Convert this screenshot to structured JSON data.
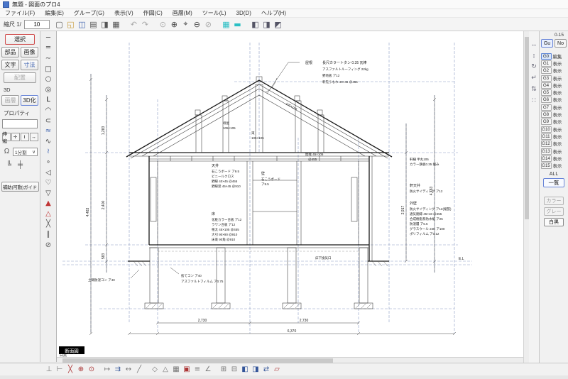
{
  "window": {
    "title": "無題 - 図面のプロ4"
  },
  "menu": {
    "items": [
      "ファイル(F)",
      "編集(E)",
      "グループ(G)",
      "表示(V)",
      "作図(C)",
      "画層(M)",
      "ツール(L)",
      "3D(D)",
      "ヘルプ(H)"
    ]
  },
  "toolbar": {
    "scale_label": "縮尺 1/",
    "scale_value": "10",
    "icons": [
      {
        "name": "new-icon",
        "glyph": "▢",
        "color": "#555"
      },
      {
        "name": "open-icon",
        "glyph": "◱",
        "color": "#c79b3b"
      },
      {
        "name": "save-icon",
        "glyph": "◫",
        "color": "#3a5fae"
      },
      {
        "name": "print-preview-icon",
        "glyph": "▤",
        "color": "#555"
      },
      {
        "name": "plot-icon",
        "glyph": "◨",
        "color": "#555"
      },
      {
        "name": "print-icon",
        "glyph": "▦",
        "color": "#555"
      },
      {
        "name": "sep1"
      },
      {
        "name": "undo-icon",
        "glyph": "↶",
        "color": "#aaaaaa"
      },
      {
        "name": "redo-icon",
        "glyph": "↷",
        "color": "#aaaaaa"
      },
      {
        "name": "sep2"
      },
      {
        "name": "zoom-all-icon",
        "glyph": "⊙",
        "color": "#aaaaaa"
      },
      {
        "name": "zoom-in-icon",
        "glyph": "⊕",
        "color": "#444"
      },
      {
        "name": "zoom-pan-icon",
        "glyph": "⌖",
        "color": "#444"
      },
      {
        "name": "zoom-out-icon",
        "glyph": "⊖",
        "color": "#444"
      },
      {
        "name": "zoom-window-icon",
        "glyph": "⊘",
        "color": "#aaaaaa"
      },
      {
        "name": "sep3"
      },
      {
        "name": "grid-icon",
        "glyph": "▦",
        "color": "#2bbfc4"
      },
      {
        "name": "paper-icon",
        "glyph": "▬",
        "color": "#2bbfc4"
      },
      {
        "name": "sep4"
      },
      {
        "name": "layer-window-icon",
        "glyph": "◧",
        "color": "#556"
      },
      {
        "name": "parts-window-icon",
        "glyph": "◨",
        "color": "#556"
      },
      {
        "name": "props-window-icon",
        "glyph": "◩",
        "color": "#556"
      }
    ]
  },
  "left_panel": {
    "select": "選択",
    "parts": "部品",
    "image": "画像",
    "text": "文字",
    "dimension": "寸法",
    "layout": "配置",
    "threed_label": "3D",
    "layer_btn": "画層",
    "to3d": "3D化",
    "property_label": "プロパティ",
    "mini_buttons": [
      "伸縮",
      "✛",
      "Ⅰ",
      "↔"
    ],
    "snap_value": "1分割",
    "snap_caret": "∨",
    "magnet_glyph": "Ω",
    "snap_icons": [
      "╚",
      "╪"
    ],
    "guide_button": "補助(可動)ガイド"
  },
  "tool_strip": {
    "tools": [
      {
        "name": "line-tool",
        "glyph": "─",
        "color": "#444"
      },
      {
        "name": "double-line-tool",
        "glyph": "═",
        "color": "#444"
      },
      {
        "name": "spline-tool",
        "glyph": "∼",
        "color": "#444"
      },
      {
        "name": "rect-tool",
        "glyph": "□",
        "color": "#444"
      },
      {
        "name": "circle-tool",
        "glyph": "○",
        "color": "#444"
      },
      {
        "name": "concentric-tool",
        "glyph": "◎",
        "color": "#444"
      },
      {
        "name": "polyline-tool",
        "glyph": "L",
        "color": "#111"
      },
      {
        "name": "arc-tool",
        "glyph": "◠",
        "color": "#444"
      },
      {
        "name": "arc3-tool",
        "glyph": "⊂",
        "color": "#444"
      },
      {
        "name": "wave-tool",
        "glyph": "≈",
        "color": "#3a5fae"
      },
      {
        "name": "freecurve-tool",
        "glyph": "∿",
        "color": "#444"
      },
      {
        "name": "curve-tool",
        "glyph": "≀",
        "color": "#3a5fae"
      },
      {
        "name": "point-tool",
        "glyph": "∘",
        "color": "#444"
      },
      {
        "name": "balloon-tool",
        "glyph": "◁",
        "color": "#444"
      },
      {
        "name": "cloud-tool",
        "glyph": "♡",
        "color": "#444"
      },
      {
        "name": "hatch-tool",
        "glyph": "▽",
        "color": "#444"
      },
      {
        "name": "fill-tool",
        "glyph": "▲",
        "color": "#c03535"
      },
      {
        "name": "pattern-tool",
        "glyph": "△",
        "color": "#c03535"
      },
      {
        "name": "cut-tool",
        "glyph": "╳",
        "color": "#555"
      },
      {
        "name": "offset-tool",
        "glyph": "∥",
        "color": "#555"
      },
      {
        "name": "erase-tool",
        "glyph": "⊘",
        "color": "#555"
      }
    ]
  },
  "right_toolbar": {
    "icons": [
      {
        "name": "scroll-horizontal-icon",
        "glyph": "↔"
      },
      {
        "name": "scroll-vertical-icon",
        "glyph": "↕"
      },
      {
        "name": "view-rotate-icon",
        "glyph": "↻"
      },
      {
        "name": "view-back-icon",
        "glyph": "↵"
      },
      {
        "name": "view-updown-icon",
        "glyph": "⇅"
      },
      {
        "name": "view-grid-icon",
        "glyph": "∷"
      }
    ]
  },
  "layer_panel": {
    "range_label": "0-15",
    "group_button": "Gu",
    "number_button": "No",
    "layers": [
      {
        "id": "G0",
        "state": "編集",
        "active": true
      },
      {
        "id": "G1",
        "state": "表示"
      },
      {
        "id": "G2",
        "state": "表示"
      },
      {
        "id": "G3",
        "state": "表示"
      },
      {
        "id": "G4",
        "state": "表示"
      },
      {
        "id": "G5",
        "state": "表示"
      },
      {
        "id": "G6",
        "state": "表示"
      },
      {
        "id": "G7",
        "state": "表示"
      },
      {
        "id": "G8",
        "state": "表示"
      },
      {
        "id": "G9",
        "state": "表示"
      },
      {
        "id": "G10",
        "state": "表示"
      },
      {
        "id": "G11",
        "state": "表示"
      },
      {
        "id": "G12",
        "state": "表示"
      },
      {
        "id": "G13",
        "state": "表示"
      },
      {
        "id": "G14",
        "state": "表示"
      },
      {
        "id": "G15",
        "state": "表示"
      }
    ],
    "all_label": "ALL",
    "list_button": "一覧",
    "color_modes": [
      {
        "label": "カラー"
      },
      {
        "label": "グレー"
      },
      {
        "label": "白黒",
        "active": true
      }
    ]
  },
  "bottom_toolbar": {
    "icons": [
      {
        "name": "snap-end-icon",
        "glyph": "⊥",
        "color": "#777"
      },
      {
        "name": "snap-mid-icon",
        "glyph": "⊢",
        "color": "#777"
      },
      {
        "name": "snap-int-icon",
        "glyph": "╳",
        "color": "#a33"
      },
      {
        "name": "snap-center-icon",
        "glyph": "⊕",
        "color": "#a33"
      },
      {
        "name": "snap-on-icon",
        "glyph": "⊙",
        "color": "#a33"
      },
      {
        "name": "sep1"
      },
      {
        "name": "move-icon",
        "glyph": "↦",
        "color": "#777"
      },
      {
        "name": "copy-icon",
        "glyph": "⇉",
        "color": "#359"
      },
      {
        "name": "stretch-icon",
        "glyph": "↔",
        "color": "#777"
      },
      {
        "name": "line-edit-icon",
        "glyph": "╱",
        "color": "#777"
      },
      {
        "name": "sep2"
      },
      {
        "name": "rect-edit-icon",
        "glyph": "◇",
        "color": "#777"
      },
      {
        "name": "poly-edit-icon",
        "glyph": "△",
        "color": "#777"
      },
      {
        "name": "hatch-edit-icon",
        "glyph": "▦",
        "color": "#777"
      },
      {
        "name": "fill-edit-icon",
        "glyph": "▣",
        "color": "#a33"
      },
      {
        "name": "text-edit-icon",
        "glyph": "≡",
        "color": "#777"
      },
      {
        "name": "measure-icon",
        "glyph": "∠",
        "color": "#777"
      },
      {
        "name": "sep3"
      },
      {
        "name": "group-icon",
        "glyph": "⊞",
        "color": "#777"
      },
      {
        "name": "ungroup-icon",
        "glyph": "⊟",
        "color": "#777"
      },
      {
        "name": "bring-front-icon",
        "glyph": "◧",
        "color": "#359"
      },
      {
        "name": "send-back-icon",
        "glyph": "◨",
        "color": "#359"
      },
      {
        "name": "swap-icon",
        "glyph": "⇄",
        "color": "#359"
      },
      {
        "name": "window-edit-icon",
        "glyph": "▱",
        "color": "#a33"
      }
    ]
  },
  "canvas": {
    "view_label": "断面図",
    "mode_label": "白黒",
    "annotations": {
      "roof_spec": {
        "label": "屋根",
        "lines": [
          "長尺カラートタン 0.35 瓦棒",
          "アスファルトルーフィング 22kg",
          "野地板 ア12",
          "軒先うもれ 40×45 @455"
        ]
      },
      "framing": {
        "moya_label": "母屋",
        "moya_size": "105×105",
        "tsuka_label": "束",
        "tsuka_size": "105×105",
        "slope_size": "105×105"
      },
      "ceiling": {
        "label": "天井",
        "lines": [
          "石こうボード ア9.5",
          "ビニールクロス",
          "野縁 40×45 @455",
          "野縁受 45×45 @910"
        ]
      },
      "wall": {
        "label": "壁",
        "lines": [
          "石こうボード",
          "ア9.5"
        ]
      },
      "floor": {
        "label": "床",
        "lines": [
          "化粧カラー合板 ア12",
          "ラワン合板 ア12",
          "根太 45×105 @455",
          "大引 90×90 @910",
          "床束 90角 @910"
        ]
      },
      "stud": {
        "lines": [
          "間柱 45×105",
          "@455"
        ]
      },
      "gutter": {
        "lines": [
          "軒樋 半丸105",
          "カラー鉄板0.35 掴み"
        ]
      },
      "soffit": {
        "label": "軒天井",
        "lines": [
          "防火サイディング ア12"
        ]
      },
      "ext_wall": {
        "label": "外壁",
        "lines": [
          "防火サイディング ア12(縦張)",
          "通気胴縁 45×18 @455",
          "合成樹脂系防水紙 ア25",
          "防湿層 ア5.5",
          "グラスウール 24K ア100",
          "ポリフィルム ア0.12"
        ]
      },
      "foundation": {
        "lines": [
          "捨てコン ア40",
          "アスファルトフィルム ア0.75"
        ]
      },
      "slab": "土間防湿コン ア40",
      "vent": "床下換気口"
    },
    "dims": {
      "bottom_inner": [
        "2,730",
        "2,730"
      ],
      "bottom_outer": "6,370",
      "left": [
        "1,283",
        "2,400",
        "583"
      ],
      "left_outer": "4,483",
      "right": [
        "2,917",
        "4,183"
      ],
      "el_label": "E.L"
    }
  }
}
